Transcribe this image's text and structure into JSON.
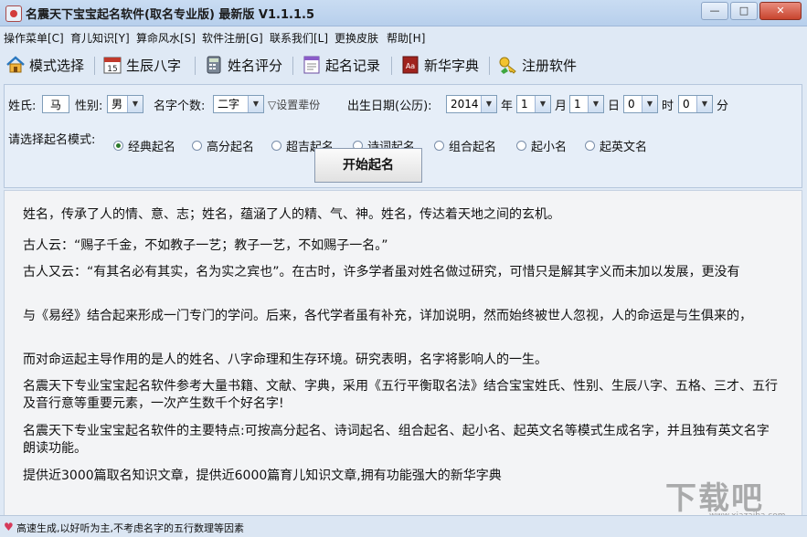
{
  "window": {
    "title": "名震天下宝宝起名软件(取名专业版) 最新版 V1.1.1.5"
  },
  "menu": [
    "操作菜单[C]",
    "育儿知识[Y]",
    "算命风水[S]",
    "软件注册[G]",
    "联系我们[L]",
    "更换皮肤",
    "帮助[H]"
  ],
  "toolbar": {
    "mode_select": "模式选择",
    "birth_bazi": "生辰八字",
    "name_score": "姓名评分",
    "naming_record": "起名记录",
    "xinhua_dict": "新华字典",
    "register": "注册软件"
  },
  "form": {
    "surname_label": "姓氏:",
    "surname_value": "马",
    "gender_label": "性别:",
    "gender_value": "男",
    "name_count_label": "名字个数:",
    "name_count_value": "二字",
    "set_fixed_word": "▽设置辈份",
    "birth_label": "出生日期(公历):",
    "year_value": "2014",
    "year_unit": "年",
    "month_value": "1",
    "month_unit": "月",
    "day_value": "1",
    "day_unit": "日",
    "hour_value": "0",
    "hour_unit": "时",
    "minute_value": "0",
    "minute_unit": "分",
    "mode_label": "请选择起名模式:",
    "modes": [
      "经典起名",
      "高分起名",
      "超吉起名",
      "诗词起名",
      "组合起名",
      "起小名",
      "起英文名"
    ],
    "selected_mode": "经典起名",
    "start_button": "开始起名"
  },
  "content": [
    "姓名，传承了人的情、意、志；姓名，蕴涵了人的精、气、神。姓名，传达着天地之间的玄机。",
    "古人云：“赐子千金，不如教子一艺；教子一艺，不如赐子一名。”",
    "古人又云：“有其名必有其实，名为实之宾也”。在古时，许多学者虽对姓名做过研究，可惜只是解其字义而未加以发展，更没有",
    "与《易经》结合起来形成一门专门的学问。后来，各代学者虽有补充，详加说明，然而始终被世人忽视，人的命运是与生俱来的，",
    "而对命运起主导作用的是人的姓名、八字命理和生存环境。研究表明，名字将影响人的一生。",
    "名震天下专业宝宝起名软件参考大量书籍、文献、字典，采用《五行平衡取名法》结合宝宝姓氏、性别、生辰八字、五格、三才、五行及音行意等重要元素，一次产生数千个好名字!",
    "名震天下专业宝宝起名软件的主要特点:可按高分起名、诗词起名、组合起名、起小名、起英文名等模式生成名字，并且独有英文名字朗读功能。",
    "提供近3000篇取名知识文章，提供近6000篇育儿知识文章,拥有功能强大的新华字典"
  ],
  "status": {
    "text": "高速生成,以好听为主,不考虑名字的五行数理等因素"
  },
  "watermark": {
    "main": "下载吧",
    "sub": "www.xiazaiba.com"
  }
}
